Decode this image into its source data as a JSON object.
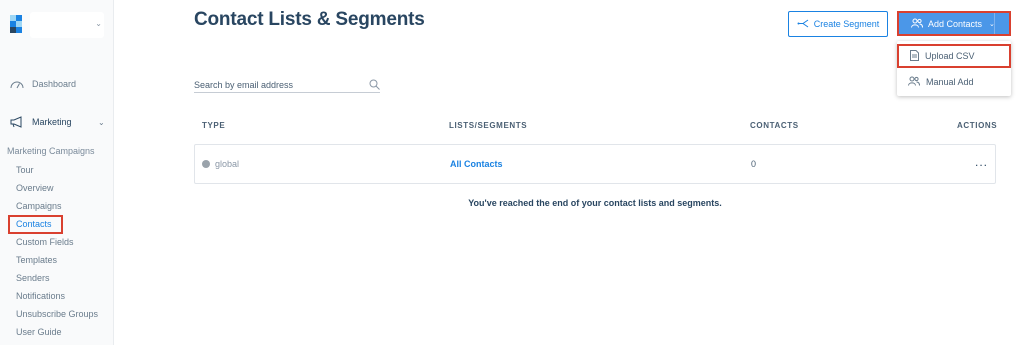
{
  "sidebar": {
    "dashboard_label": "Dashboard",
    "marketing_label": "Marketing",
    "section_heading": "Marketing Campaigns",
    "items": [
      {
        "label": "Tour"
      },
      {
        "label": "Overview"
      },
      {
        "label": "Campaigns"
      },
      {
        "label": "Contacts"
      },
      {
        "label": "Custom Fields"
      },
      {
        "label": "Templates"
      },
      {
        "label": "Senders"
      },
      {
        "label": "Notifications"
      },
      {
        "label": "Unsubscribe Groups"
      },
      {
        "label": "User Guide"
      }
    ]
  },
  "header": {
    "title": "Contact Lists & Segments",
    "create_segment_label": "Create Segment",
    "add_contacts_label": "Add Contacts"
  },
  "dropdown": {
    "upload_csv_label": "Upload CSV",
    "manual_add_label": "Manual Add"
  },
  "search": {
    "placeholder": "Search by email address"
  },
  "table": {
    "columns": [
      "TYPE",
      "LISTS/SEGMENTS",
      "CONTACTS",
      "ACTIONS"
    ],
    "rows": [
      {
        "type": "global",
        "name": "All Contacts",
        "contacts": "0",
        "actions": "..."
      }
    ]
  },
  "end_message": "You've reached the end of your contact lists and segments.",
  "colors": {
    "accent": "#1a82e2",
    "highlight": "#d9402f",
    "text": "#294661"
  }
}
